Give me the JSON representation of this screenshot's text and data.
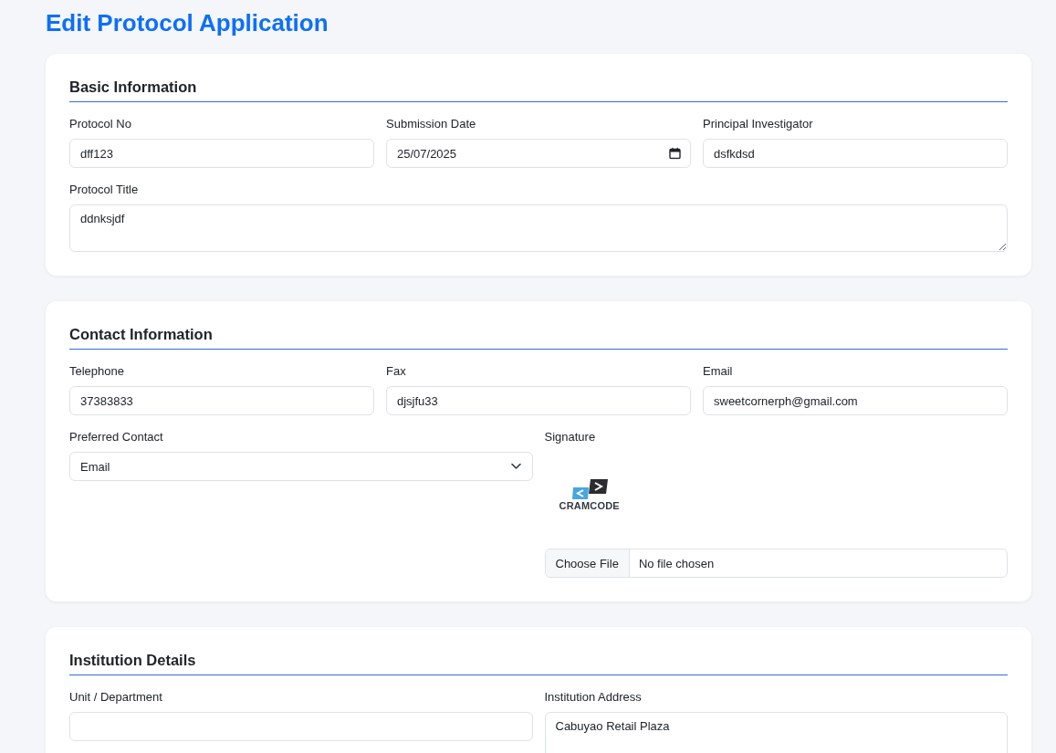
{
  "page_title": "Edit Protocol Application",
  "sections": [
    {
      "title": "Basic Information",
      "rows": [
        [
          {
            "kind": "text",
            "label": "Protocol No",
            "value": "dff123"
          },
          {
            "kind": "date",
            "label": "Submission Date",
            "value": "25/07/2025"
          },
          {
            "kind": "text",
            "label": "Principal Investigator",
            "value": "dsfkdsd"
          }
        ],
        [
          {
            "kind": "textarea",
            "label": "Protocol Title",
            "value": "ddnksjdf"
          }
        ]
      ]
    },
    {
      "title": "Contact Information",
      "rows": [
        [
          {
            "kind": "text",
            "label": "Telephone",
            "value": "37383833"
          },
          {
            "kind": "text",
            "label": "Fax",
            "value": "djsjfu33"
          },
          {
            "kind": "text",
            "label": "Email",
            "value": "sweetcornerph@gmail.com"
          }
        ],
        [
          {
            "kind": "select",
            "label": "Preferred Contact",
            "value": "Email"
          },
          {
            "kind": "signature",
            "label": "Signature",
            "image_text": "CRAMCODE",
            "button": "Choose File",
            "file_status": "No file chosen"
          }
        ]
      ]
    },
    {
      "title": "Institution Details",
      "rows": [
        [
          {
            "kind": "text",
            "label": "Unit / Department"
          },
          {
            "kind": "textarea",
            "label": "Institution Address",
            "value": "Cabuyao Retail Plaza"
          }
        ]
      ]
    }
  ]
}
